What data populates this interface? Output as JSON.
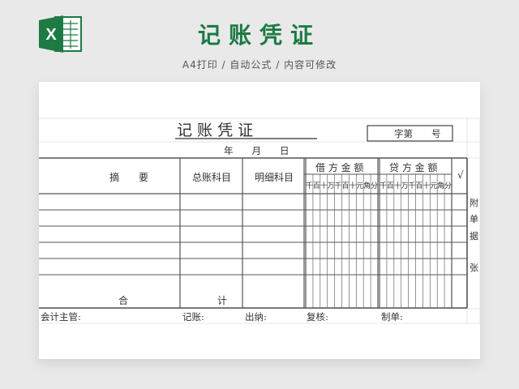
{
  "header": {
    "title": "记账凭证",
    "subtitle": "A4打印 / 自动公式 / 内容可修改",
    "app_icon": "excel-icon",
    "app_icon_letter": "X"
  },
  "voucher": {
    "title": "记 账 凭 证",
    "number_label": "字第　　号",
    "date_label": "年　　月　　日",
    "columns": {
      "summary": "摘　　要",
      "general_account": "总账科目",
      "detail_account": "明细科目",
      "debit": "借 方 金 额",
      "credit": "贷 方 金 额",
      "check": "√"
    },
    "digit_units": [
      "千",
      "百",
      "十",
      "万",
      "千",
      "百",
      "十",
      "元",
      "角",
      "分"
    ],
    "attachment": [
      "附",
      "单",
      "据",
      "张"
    ],
    "total_label_1": "合",
    "total_label_2": "计",
    "footer": {
      "supervisor": "会计主管:",
      "bookkeeper": "记账:",
      "cashier": "出纳:",
      "reviewer": "复核:",
      "preparer": "制单:"
    },
    "data_rows": 6
  },
  "colors": {
    "brand_green": "#1d7a45",
    "grid": "#555555",
    "light_grid": "#d8d8d8"
  }
}
